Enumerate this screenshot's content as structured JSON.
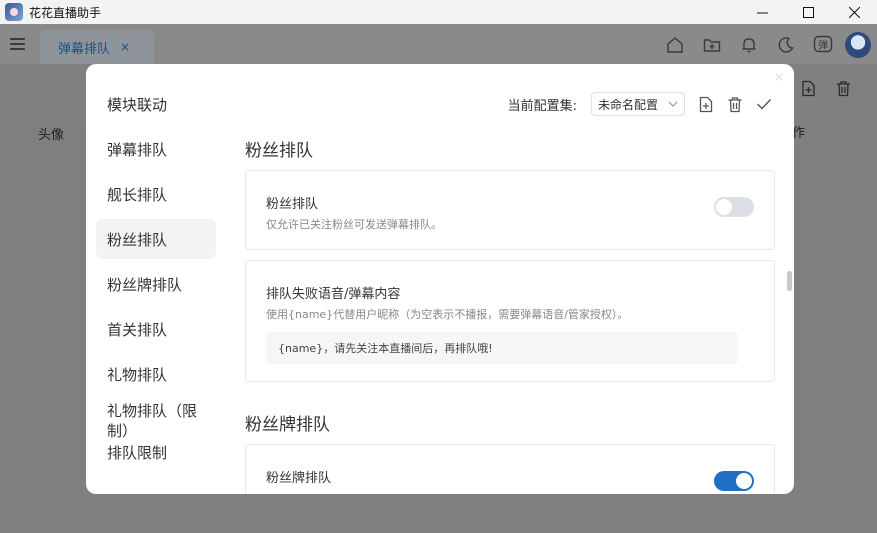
{
  "window": {
    "title": "花花直播助手",
    "minimize": "—",
    "maximize": "☐",
    "close": "✕"
  },
  "app": {
    "tab_label": "弹幕排队",
    "tab_close": "×",
    "top_icons": [
      "home-icon",
      "folder-add-icon",
      "bell-icon",
      "moon-icon",
      "danmaku-icon",
      "avatar"
    ],
    "danmaku_icon_text": "弹",
    "bg_col_head": "头像",
    "bg_col_head2": "作"
  },
  "modal": {
    "close": "×",
    "config_label": "当前配置集:",
    "config_value": "未命名配置",
    "sidebar": [
      {
        "label": "模块联动",
        "active": false
      },
      {
        "label": "弹幕排队",
        "active": false
      },
      {
        "label": "舰长排队",
        "active": false
      },
      {
        "label": "粉丝排队",
        "active": true
      },
      {
        "label": "粉丝牌排队",
        "active": false
      },
      {
        "label": "首关排队",
        "active": false
      },
      {
        "label": "礼物排队",
        "active": false
      },
      {
        "label": "礼物排队（限制）",
        "active": false
      },
      {
        "label": "排队限制",
        "active": false
      }
    ],
    "section1_title": "粉丝排队",
    "card1": {
      "title": "粉丝排队",
      "desc": "仅允许已关注粉丝可发送弹幕排队。",
      "enabled": false
    },
    "card2": {
      "title": "排队失败语音/弹幕内容",
      "desc": "使用{name}代替用户昵称（为空表示不播报，需要弹幕语音/管家授权）。",
      "value": "{name}，请先关注本直播间后，再排队哦!"
    },
    "section2_title": "粉丝牌排队",
    "card3": {
      "title": "粉丝牌排队",
      "enabled": true
    }
  },
  "colors": {
    "accent": "#1f6fc5",
    "tab_text": "#1a4f8a"
  }
}
